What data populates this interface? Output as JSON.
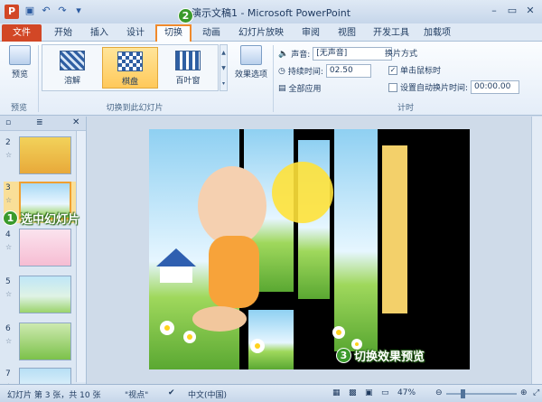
{
  "app": {
    "title": "演示文稿1 - Microsoft PowerPoint",
    "logo_letter": "P"
  },
  "quick_access": [
    "save-icon",
    "undo-icon",
    "redo-icon",
    "customize-icon"
  ],
  "window_controls": [
    "minimize-icon",
    "maximize-icon",
    "close-icon"
  ],
  "tabs": [
    {
      "label": "文件"
    },
    {
      "label": "开始"
    },
    {
      "label": "插入"
    },
    {
      "label": "设计"
    },
    {
      "label": "切换"
    },
    {
      "label": "动画"
    },
    {
      "label": "幻灯片放映"
    },
    {
      "label": "审阅"
    },
    {
      "label": "视图"
    },
    {
      "label": "开发工具"
    },
    {
      "label": "加载项"
    }
  ],
  "ribbon": {
    "preview": {
      "label": "预览",
      "group": "预览"
    },
    "gallery": {
      "items": [
        {
          "label": "溶解"
        },
        {
          "label": "棋盘"
        },
        {
          "label": "百叶窗"
        }
      ],
      "group": "切换到此幻灯片"
    },
    "effect_options": {
      "label": "效果选项"
    },
    "timing": {
      "group": "计时",
      "sound_label": "声音:",
      "sound_value": "[无声音]",
      "duration_label": "持续时间:",
      "duration_value": "02.50",
      "apply_all": "全部应用",
      "advance_title": "换片方式",
      "on_click_label": "单击鼠标时",
      "on_click_checked": true,
      "after_label": "设置自动换片时间:",
      "after_checked": false,
      "after_value": "00:00.00"
    }
  },
  "slides": [
    {
      "num": "2"
    },
    {
      "num": "3"
    },
    {
      "num": "4"
    },
    {
      "num": "5"
    },
    {
      "num": "6"
    },
    {
      "num": "7"
    }
  ],
  "callouts": {
    "c1": {
      "num": "1",
      "text": "选中幻灯片"
    },
    "c2": {
      "num": "2"
    },
    "c3": {
      "num": "3",
      "text": "切换效果预览"
    }
  },
  "status": {
    "slide_info": "幻灯片 第 3 张，共 10 张",
    "theme": "\"视点\"",
    "language": "中文(中国)",
    "zoom": "47%",
    "zoom_fraction": 0.47
  }
}
